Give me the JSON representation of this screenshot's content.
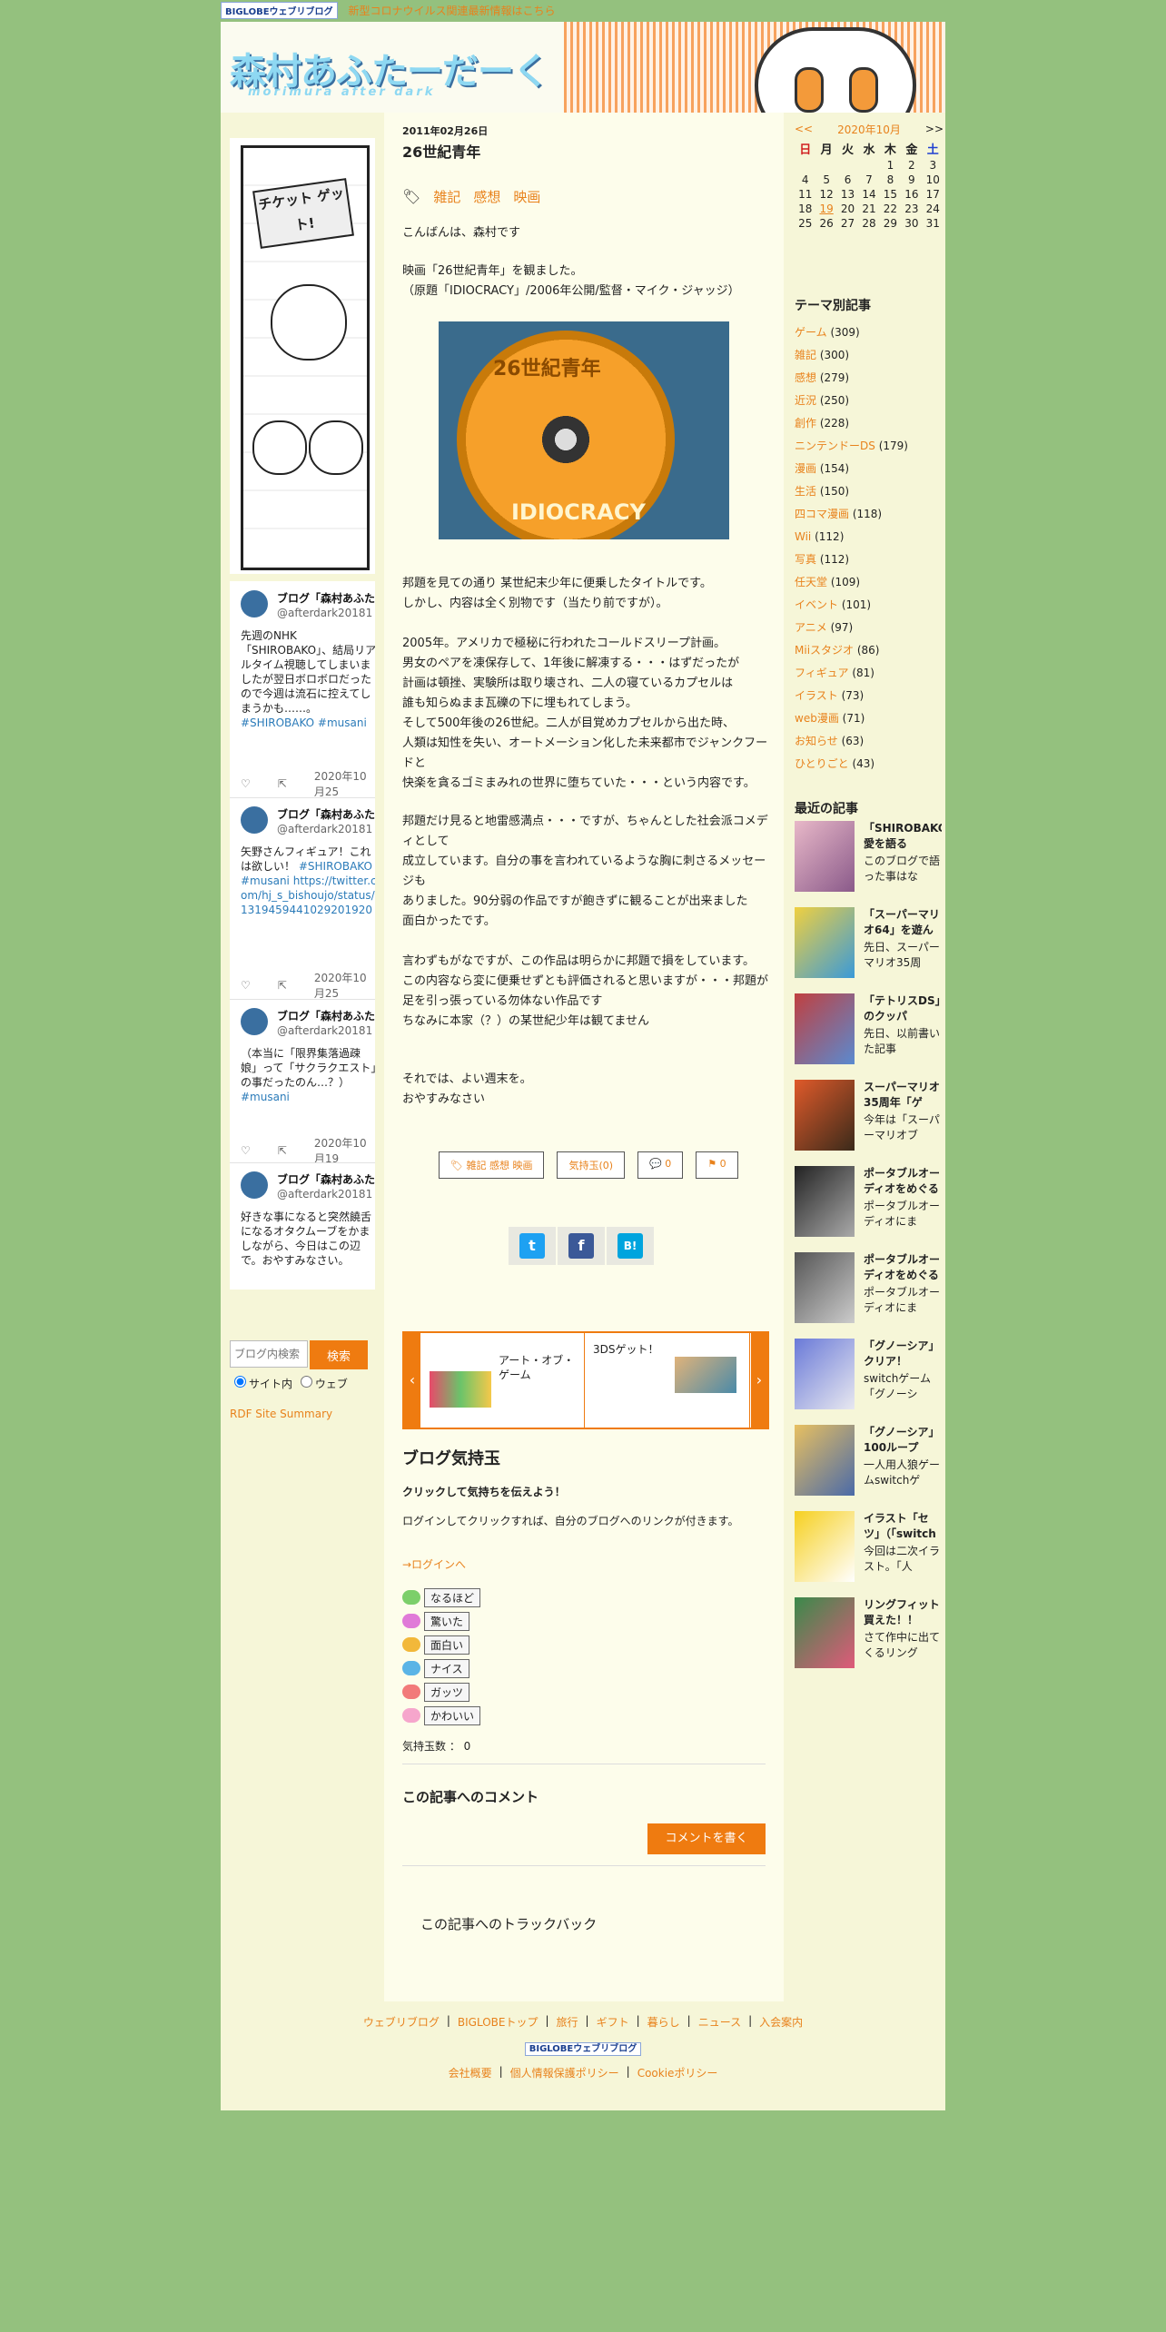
{
  "topbar": {
    "logo": "BIGLOBEウェブリブログ",
    "notice": "新型コロナウイルス関連最新情報はこちら"
  },
  "header": {
    "title": "森村あふたーだーく",
    "subtitle": "morimura after dark"
  },
  "left": {
    "comic_label": "チケット ゲット!",
    "tweets": [
      {
        "name": "ブログ「森村あふた",
        "handle": "@afterdark20181",
        "text": "先週のNHK「SHIROBAKO」、結局リアルタイム視聴してしまいましたが翌日ボロボロだったので今週は流石に控えてしまうかも……。",
        "tags": "#SHIROBAKO #musani",
        "date": "2020年10月25"
      },
      {
        "name": "ブログ「森村あふた",
        "handle": "@afterdark20181",
        "text": "矢野さんフィギュア！これは欲しい！",
        "tags": "#SHIROBAKO #musani https://twitter.com/hj_s_bishoujo/status/1319459441029201920",
        "date": "2020年10月25"
      },
      {
        "name": "ブログ「森村あふた",
        "handle": "@afterdark20181",
        "text": "（本当に「限界集落過疎娘」って「サクラクエスト」の事だったのん…？）",
        "tags": "#musani",
        "date": "2020年10月19"
      },
      {
        "name": "ブログ「森村あふた",
        "handle": "@afterdark20181",
        "text": "好きな事になると突然饒舌になるオタクムーブをかましながら、今日はこの辺で。おやすみなさい。",
        "tags": "",
        "date": ""
      }
    ],
    "search": {
      "placeholder": "ブログ内検索",
      "button": "検索",
      "opt_site": "サイト内",
      "opt_web": "ウェブ"
    },
    "rdf": "RDF Site Summary"
  },
  "article": {
    "date": "2011年02月26日",
    "title": "26世紀青年",
    "categories": [
      "雑記",
      "感想",
      "映画"
    ],
    "p1": [
      "こんばんは、森村です"
    ],
    "p2": [
      "映画「26世紀青年」を観ました。",
      "（原題「IDIOCRACY」/2006年公開/監督・マイク・ジャッジ）"
    ],
    "photo_text_top": "26世紀青年",
    "photo_text_bottom": "IDIOCRACY",
    "p3": [
      "邦題を見ての通り 某世紀末少年に便乗したタイトルです。",
      "しかし、内容は全く別物です（当たり前ですが）。"
    ],
    "p4": [
      "2005年。アメリカで極秘に行われたコールドスリープ計画。",
      "男女のペアを凍保存して、1年後に解凍する・・・はずだったが",
      "計画は頓挫、実験所は取り壊され、二人の寝ているカプセルは",
      "誰も知らぬまま瓦礫の下に埋もれてしまう。",
      "そして500年後の26世紀。二人が目覚めカプセルから出た時、",
      "人類は知性を失い、オートメーション化した未来都市でジャンクフードと",
      "快楽を貪るゴミまみれの世界に堕ちていた・・・という内容です。"
    ],
    "p5": [
      "邦題だけ見ると地雷感満点・・・ですが、ちゃんとした社会派コメディとして",
      "成立しています。自分の事を言われているような胸に刺さるメッセージも",
      "ありました。90分弱の作品ですが飽きずに観ることが出来ました",
      "面白かったです。"
    ],
    "p6": [
      "言わずもがなですが、この作品は明らかに邦題で損をしています。",
      "この内容なら変に便乗せずとも評価されると思いますが・・・邦題が",
      "足を引っ張っている勿体ない作品です",
      "ちなみに本家（？）の某世紀少年は観てません"
    ],
    "p7": [
      "それでは、よい週末を。",
      "おやすみなさい"
    ],
    "buttons": {
      "cat_tags": "雑記 感想 映画",
      "kimochi": "気持玉(0)",
      "comments": "0",
      "trackbacks": "0"
    },
    "share": {
      "twitter": "t",
      "facebook": "f",
      "hatena": "B!"
    },
    "carousel": [
      {
        "label": "アート・オブ・ゲーム"
      },
      {
        "label": "3DSゲット！"
      }
    ],
    "kimochi": {
      "heading": "ブログ気持玉",
      "lead": "クリックして気持ちを伝えよう！",
      "desc": "ログインしてクリックすれば、自分のブログへのリンクが付きます。",
      "login": "→ログインへ",
      "buttons": [
        "なるほど",
        "驚いた",
        "面白い",
        "ナイス",
        "ガッツ",
        "かわいい"
      ],
      "count_label": "気持玉数 ： 0"
    },
    "comments_heading": "この記事へのコメント",
    "comment_button": "コメントを書く",
    "trackback_heading": "この記事へのトラックバック"
  },
  "calendar": {
    "prev": "<<",
    "month": "2020年10月",
    "next": ">>",
    "weekdays": [
      "日",
      "月",
      "火",
      "水",
      "木",
      "金",
      "土"
    ],
    "days": [
      "",
      "",
      "",
      "",
      "1",
      "2",
      "3",
      "4",
      "5",
      "6",
      "7",
      "8",
      "9",
      "10",
      "11",
      "12",
      "13",
      "14",
      "15",
      "16",
      "17",
      "18",
      "19",
      "20",
      "21",
      "22",
      "23",
      "24",
      "25",
      "26",
      "27",
      "28",
      "29",
      "30",
      "31"
    ],
    "highlight": "19"
  },
  "themes": {
    "heading": "テーマ別記事",
    "items": [
      {
        "name": "ゲーム",
        "count": "(309)"
      },
      {
        "name": "雑記",
        "count": "(300)"
      },
      {
        "name": "感想",
        "count": "(279)"
      },
      {
        "name": "近況",
        "count": "(250)"
      },
      {
        "name": "創作",
        "count": "(228)"
      },
      {
        "name": "ニンテンドーDS",
        "count": "(179)"
      },
      {
        "name": "漫画",
        "count": "(154)"
      },
      {
        "name": "生活",
        "count": "(150)"
      },
      {
        "name": "四コマ漫画",
        "count": "(118)"
      },
      {
        "name": "Wii",
        "count": "(112)"
      },
      {
        "name": "写真",
        "count": "(112)"
      },
      {
        "name": "任天堂",
        "count": "(109)"
      },
      {
        "name": "イベント",
        "count": "(101)"
      },
      {
        "name": "アニメ",
        "count": "(97)"
      },
      {
        "name": "Miiスタジオ",
        "count": "(86)"
      },
      {
        "name": "フィギュア",
        "count": "(81)"
      },
      {
        "name": "イラスト",
        "count": "(73)"
      },
      {
        "name": "web漫画",
        "count": "(71)"
      },
      {
        "name": "お知らせ",
        "count": "(63)"
      },
      {
        "name": "ひとりごと",
        "count": "(43)"
      }
    ]
  },
  "recent": {
    "heading": "最近の記事",
    "items": [
      {
        "title": "「SHIROBAKO」愛を語る",
        "excerpt": "このブログで語った事はな"
      },
      {
        "title": "「スーパーマリオ64」を遊んだ",
        "excerpt": "先日、スーパーマリオ35周"
      },
      {
        "title": "「テトリスDS」のクッパ",
        "excerpt": "先日、以前書いた記事"
      },
      {
        "title": "スーパーマリオ35周年「ゲ",
        "excerpt": "今年は「スーパーマリオブ"
      },
      {
        "title": "ポータブルオーディオをめぐる",
        "excerpt": "ポータブルオーディオにま"
      },
      {
        "title": "ポータブルオーディオをめぐる",
        "excerpt": "ポータブルオーディオにま"
      },
      {
        "title": "「グノーシア」クリア！",
        "excerpt": "switchゲーム「グノーシ"
      },
      {
        "title": "「グノーシア」100ループ",
        "excerpt": "一人用人狼ゲームswitchゲ"
      },
      {
        "title": "イラスト「セツ」（「switch",
        "excerpt": "今回は二次イラスト。「人"
      },
      {
        "title": "リングフィット買えた！！",
        "excerpt": "さて作中に出てくるリング"
      }
    ]
  },
  "footer": {
    "links": [
      "ウェブリブログ",
      "BIGLOBEトップ",
      "旅行",
      "ギフト",
      "暮らし",
      "ニュース",
      "入会案内"
    ],
    "logo": "BIGLOBEウェブリブログ",
    "links2": [
      "会社概要",
      "個人情報保護ポリシー",
      "Cookieポリシー"
    ]
  },
  "colors": {
    "accent": "#ef7b10",
    "link": "#e8821c",
    "background": "#94c17e",
    "panel": "#f6f6d8"
  }
}
